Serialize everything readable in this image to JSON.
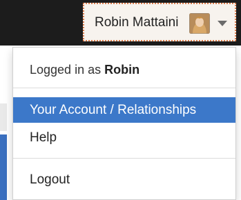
{
  "header": {
    "user_name": "Robin Mattaini",
    "avatar_icon": "user-avatar",
    "caret_icon": "chevron-down-icon"
  },
  "dropdown": {
    "logged_in_prefix": "Logged in as ",
    "logged_in_user": "Robin",
    "items": [
      {
        "label": "Your Account / Relationships",
        "active": true
      },
      {
        "label": "Help",
        "active": false
      },
      {
        "label": "Logout",
        "active": false
      }
    ]
  },
  "colors": {
    "active_item_bg": "#3c78c9",
    "topbar_bg": "#1c1c1c"
  }
}
